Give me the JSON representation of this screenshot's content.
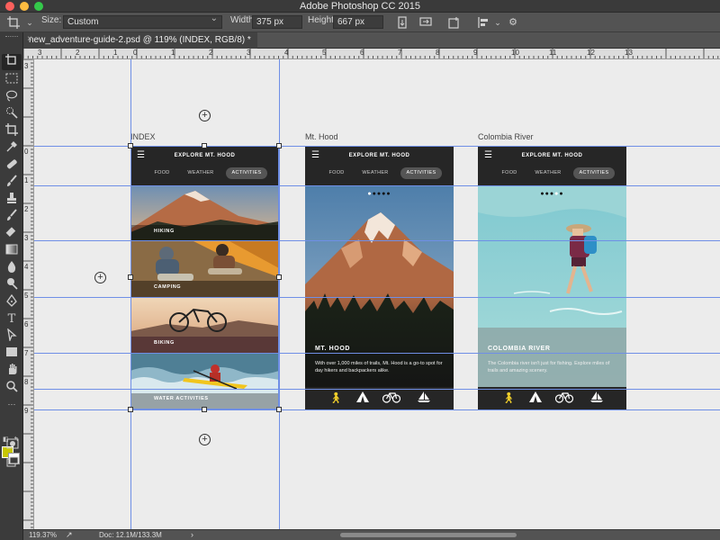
{
  "window": {
    "title": "Adobe Photoshop CC 2015"
  },
  "options_bar": {
    "size_label": "Size:",
    "size_value": "Custom",
    "width_label": "Width:",
    "width_value": "375 px",
    "height_label": "Height:",
    "height_value": "667 px"
  },
  "document": {
    "tab_title": "new_adventure-guide-2.psd @ 119% (INDEX, RGB/8) *"
  },
  "rulers": {
    "top": [
      "3",
      "2",
      "1",
      "0",
      "1",
      "2",
      "3",
      "4",
      "5",
      "6",
      "7",
      "8",
      "9",
      "10",
      "11",
      "12",
      "13"
    ],
    "left": [
      "3",
      "0",
      "1",
      "2",
      "3",
      "4",
      "5",
      "6",
      "7",
      "8",
      "9"
    ]
  },
  "toolbox": {
    "foreground_color": "#c8c700",
    "background_color": "#ffffff",
    "tools": [
      "artboard",
      "marquee",
      "lasso",
      "quick-select",
      "crop",
      "eyedropper",
      "healing",
      "brush",
      "stamp",
      "history-brush",
      "eraser",
      "gradient",
      "blur",
      "dodge",
      "pen",
      "type",
      "path-select",
      "shape",
      "hand",
      "zoom"
    ]
  },
  "artboards": [
    {
      "label": "INDEX",
      "app_title": "EXPLORE MT. HOOD",
      "tabs": [
        "FOOD",
        "WEATHER",
        "ACTIVITIES"
      ],
      "active_tab": "ACTIVITIES",
      "tiles": [
        "HIKING",
        "CAMPING",
        "BIKING",
        "WATER ACTIVITIES"
      ]
    },
    {
      "label": "Mt. Hood",
      "app_title": "EXPLORE MT. HOOD",
      "tabs": [
        "FOOD",
        "WEATHER",
        "ACTIVITIES"
      ],
      "active_tab": "ACTIVITIES",
      "hero_title": "MT. HOOD",
      "hero_text": "With over 1,000 miles of trails, Mt. Hood is a go-to spot for day hikers and backpackers alike."
    },
    {
      "label": "Colombia River",
      "app_title": "EXPLORE MT. HOOD",
      "tabs": [
        "FOOD",
        "WEATHER",
        "ACTIVITIES"
      ],
      "active_tab": "ACTIVITIES",
      "hero_title": "COLOMBIA RIVER",
      "hero_text": "The Colombia river isn't just for fishing. Explore miles of trails and amazing scenery."
    }
  ],
  "accent_color": "#f2d02b",
  "status": {
    "zoom": "119.37%",
    "doc": "Doc: 12.1M/133.3M"
  }
}
